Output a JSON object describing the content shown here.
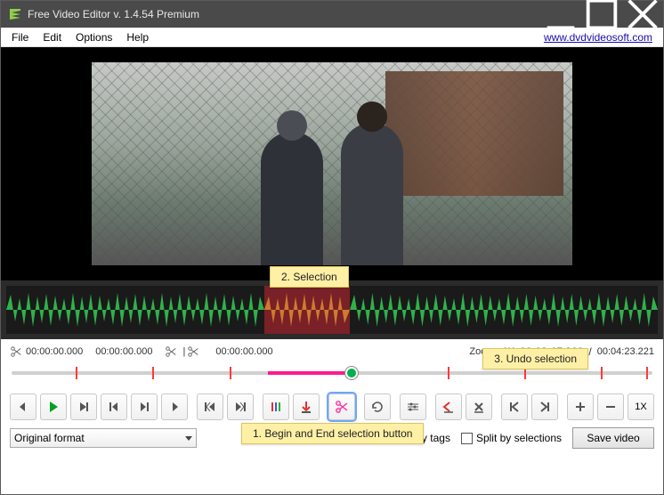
{
  "window": {
    "title": "Free Video Editor v. 1.4.54 Premium"
  },
  "menubar": {
    "file": "File",
    "edit": "Edit",
    "options": "Options",
    "help": "Help",
    "link": "www.dvdvideosoft.com"
  },
  "timecodes": {
    "cut_start": "00:00:00.000",
    "in_point": "00:00:00.000",
    "out_point": "00:00:00.000",
    "zoom_label": "Zoom:",
    "zoom_value": "1X",
    "current": "00:02:15.900",
    "slash": "/",
    "duration": "00:04:23.221"
  },
  "toolbar": {
    "zoom_1x": "1X"
  },
  "bottom": {
    "format_selected": "Original format",
    "split_tags": "Split by tags",
    "split_selections": "Split by selections",
    "save": "Save video"
  },
  "callouts": {
    "c1": "1. Begin and End selection button",
    "c2": "2. Selection",
    "c3": "3. Undo selection"
  }
}
